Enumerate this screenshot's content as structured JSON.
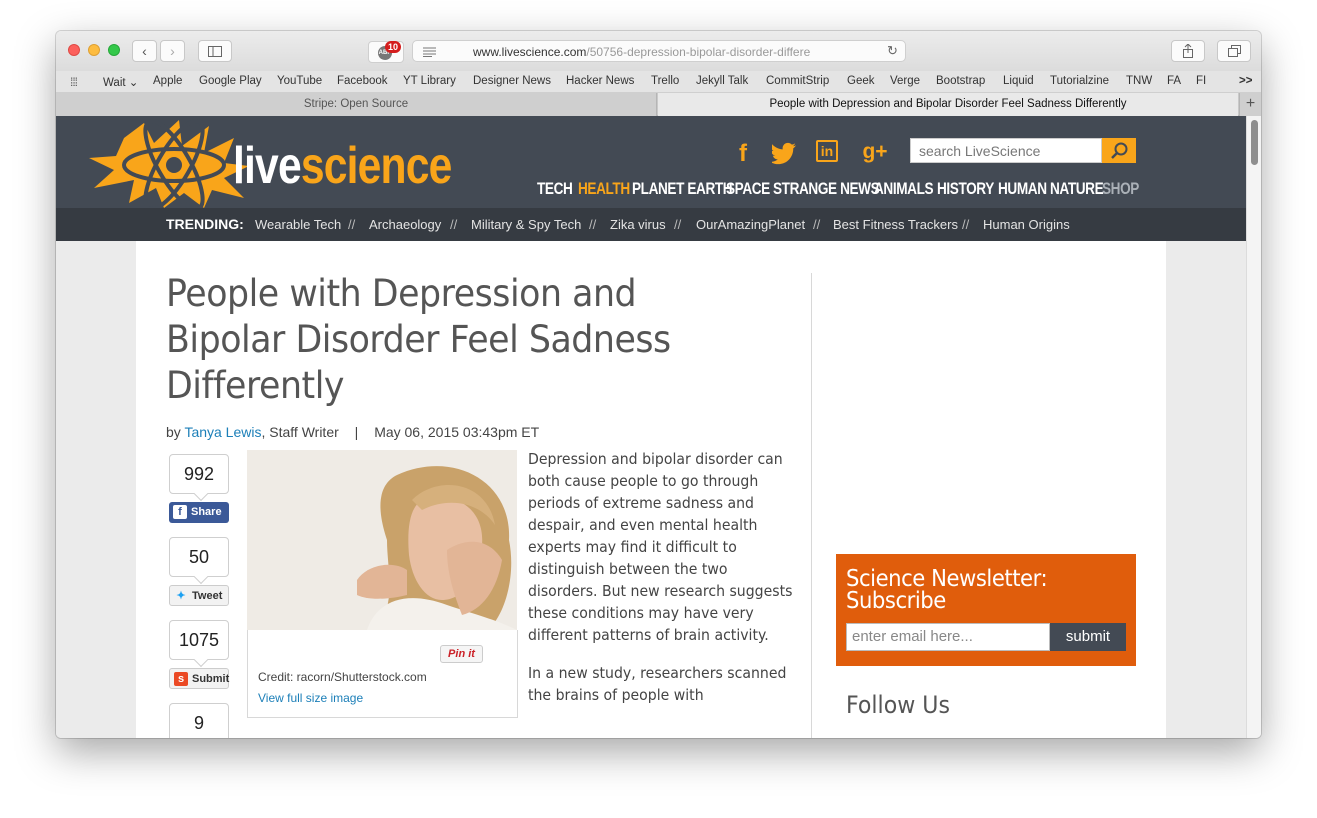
{
  "browser": {
    "address_url_main": "www.livescience.com",
    "address_url_rest": "/50756-depression-bipolar-disorder-differe",
    "adblock_badge": "10",
    "adblock_label": "ABP",
    "bookmarks": [
      "Wait ⌄",
      "Apple",
      "Google Play",
      "YouTube",
      "Facebook",
      "YT Library",
      "Designer News",
      "Hacker News",
      "Trello",
      "Jekyll Talk",
      "CommitStrip",
      "Geek",
      "Verge",
      "Bootstrap",
      "Liquid",
      "Tutorialzine",
      "TNW",
      "FA",
      "FI"
    ],
    "bookmarks_overflow": ">>",
    "tabs": [
      {
        "label": "Stripe: Open Source",
        "active": false
      },
      {
        "label": "People with Depression and Bipolar Disorder Feel Sadness Differently",
        "active": true
      }
    ]
  },
  "site": {
    "logo_live": "live",
    "logo_science": "science",
    "search_placeholder": "search LiveScience",
    "nav": [
      "TECH",
      "HEALTH",
      "PLANET EARTH",
      "SPACE",
      "STRANGE NEWS",
      "ANIMALS",
      "HISTORY",
      "HUMAN NATURE",
      "SHOP"
    ],
    "trending_label": "TRENDING:",
    "trending": [
      "Wearable Tech",
      "Archaeology",
      "Military & Spy Tech",
      "Zika virus",
      "OurAmazingPlanet",
      "Best Fitness Trackers",
      "Human Origins"
    ],
    "trending_sep": "//",
    "accent_color": "#f9a51a"
  },
  "article": {
    "title": "People with Depression and Bipolar Disorder Feel Sadness Differently",
    "by": "by ",
    "author": "Tanya Lewis",
    "author_role": ", Staff Writer",
    "date_sep": "|",
    "date": "May 06, 2015 03:43pm ET",
    "paragraphs": [
      "Depression and bipolar disorder can both cause people to go through periods of extreme sadness and despair, and even mental health experts may find it difficult to distinguish between the two disorders. But new research suggests these conditions may have very different patterns of brain activity.",
      "In a new study, researchers scanned the brains of people with"
    ],
    "credit": "Credit: racorn/Shutterstock.com",
    "view_full": "View full size image",
    "pinit": "Pin it"
  },
  "share": {
    "facebook_count": "992",
    "facebook_label": "Share",
    "twitter_count": "50",
    "twitter_label": "Tweet",
    "stumble_count": "1075",
    "stumble_label": "Submit",
    "fourth_count": "9"
  },
  "sidebar": {
    "newsletter_title": "Science Newsletter: Subscribe",
    "email_placeholder": "enter email here...",
    "submit_label": "submit",
    "follow_title": "Follow Us"
  }
}
